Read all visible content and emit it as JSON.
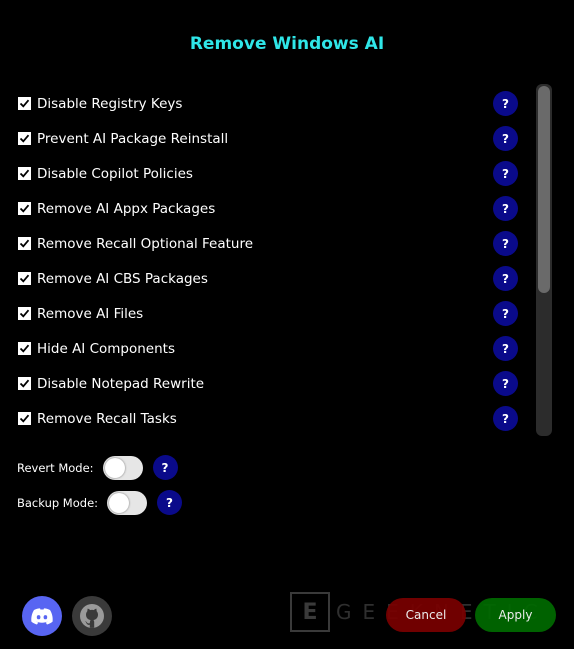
{
  "window": {
    "title": "Remove Windows AI"
  },
  "options": [
    {
      "label": "Disable Registry Keys",
      "checked": true,
      "help": "?"
    },
    {
      "label": "Prevent AI Package Reinstall",
      "checked": true,
      "help": "?"
    },
    {
      "label": "Disable Copilot Policies",
      "checked": true,
      "help": "?"
    },
    {
      "label": "Remove AI Appx Packages",
      "checked": true,
      "help": "?"
    },
    {
      "label": "Remove Recall Optional Feature",
      "checked": true,
      "help": "?"
    },
    {
      "label": "Remove AI CBS Packages",
      "checked": true,
      "help": "?"
    },
    {
      "label": "Remove AI Files",
      "checked": true,
      "help": "?"
    },
    {
      "label": "Hide AI Components",
      "checked": true,
      "help": "?"
    },
    {
      "label": "Disable Notepad Rewrite",
      "checked": true,
      "help": "?"
    },
    {
      "label": "Remove Recall Tasks",
      "checked": true,
      "help": "?"
    }
  ],
  "modes": {
    "revert": {
      "label": "Revert Mode:",
      "enabled": false,
      "help": "?"
    },
    "backup": {
      "label": "Backup Mode:",
      "enabled": false,
      "help": "?"
    }
  },
  "footer": {
    "discord_icon": "discord-icon",
    "github_icon": "github-icon",
    "cancel_label": "Cancel",
    "apply_label": "Apply",
    "watermark_box": "E",
    "watermark_text": "GEEKNETIC"
  },
  "colors": {
    "title": "#2fe6e8",
    "help_bg": "#0a0a8a",
    "cancel_bg": "#7a0000",
    "apply_bg": "#006b00",
    "discord_bg": "#5865f2"
  }
}
